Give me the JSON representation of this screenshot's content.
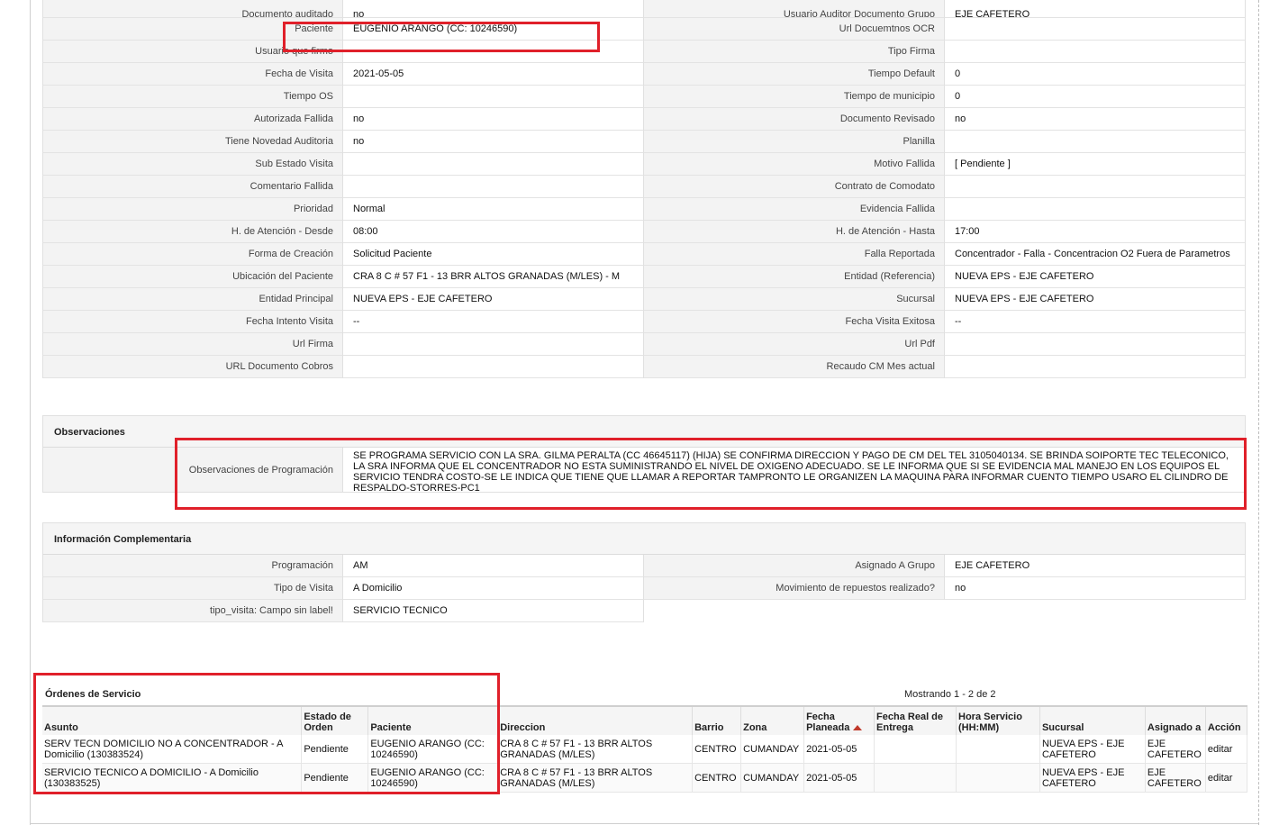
{
  "details": [
    {
      "l1": "Documento auditado",
      "v1": "no",
      "l2": "Usuario Auditor Documento Grupo",
      "v2": "EJE CAFETERO"
    },
    {
      "l1": "Paciente",
      "v1": "EUGENIO ARANGO (CC: 10246590)",
      "l2": "Url Docuemtnos OCR",
      "v2": ""
    },
    {
      "l1": "Usuario que firmo",
      "v1": "",
      "l2": "Tipo Firma",
      "v2": ""
    },
    {
      "l1": "Fecha de Visita",
      "v1": "2021-05-05",
      "l2": "Tiempo Default",
      "v2": "0"
    },
    {
      "l1": "Tiempo OS",
      "v1": "",
      "l2": "Tiempo de municipio",
      "v2": "0"
    },
    {
      "l1": "Autorizada Fallida",
      "v1": "no",
      "l2": "Documento Revisado",
      "v2": "no"
    },
    {
      "l1": "Tiene Novedad Auditoria",
      "v1": "no",
      "l2": "Planilla",
      "v2": ""
    },
    {
      "l1": "Sub Estado Visita",
      "v1": "",
      "l2": "Motivo Fallida",
      "v2": "[ Pendiente ]"
    },
    {
      "l1": "Comentario Fallida",
      "v1": "",
      "l2": "Contrato de Comodato",
      "v2": ""
    },
    {
      "l1": "Prioridad",
      "v1": "Normal",
      "l2": "Evidencia Fallida",
      "v2": ""
    },
    {
      "l1": "H. de Atención - Desde",
      "v1": "08:00",
      "l2": "H. de Atención - Hasta",
      "v2": "17:00"
    },
    {
      "l1": "Forma de Creación",
      "v1": "Solicitud Paciente",
      "l2": "Falla Reportada",
      "v2": "Concentrador - Falla - Concentracion O2 Fuera de Parametros"
    },
    {
      "l1": "Ubicación del Paciente",
      "v1": "CRA 8 C # 57 F1 - 13 BRR ALTOS GRANADAS (M/LES) - M",
      "l2": "Entidad (Referencia)",
      "v2": "NUEVA EPS - EJE CAFETERO"
    },
    {
      "l1": "Entidad Principal",
      "v1": "NUEVA EPS - EJE CAFETERO",
      "l2": "Sucursal",
      "v2": "NUEVA EPS - EJE CAFETERO"
    },
    {
      "l1": "Fecha Intento Visita",
      "v1": "--",
      "l2": "Fecha Visita Exitosa",
      "v2": "--"
    },
    {
      "l1": "Url Firma",
      "v1": "",
      "l2": "Url Pdf",
      "v2": ""
    },
    {
      "l1": "URL Documento Cobros",
      "v1": "",
      "l2": "Recaudo CM Mes actual",
      "v2": ""
    }
  ],
  "observaciones": {
    "header": "Observaciones",
    "label": "Observaciones de Programación",
    "text": " SE PROGRAMA SERVICIO CON LA SRA. GILMA PERALTA (CC 46645117) (HIJA) SE CONFIRMA DIRECCION Y PAGO DE CM DEL TEL 3105040134. SE BRINDA SOIPORTE TEC TELECONICO, LA SRA INFORMA QUE EL CONCENTRADOR NO ESTA SUMINISTRANDO EL NIVEL DE OXIGENO ADECUADO. SE LE INFORMA QUE SI SE EVIDENCIA MAL MANEJO EN LOS EQUIPOS EL SERVICIO TENDRA COSTO-SE LE INDICA QUE TIENE QUE LLAMAR A REPORTAR TAMPRONTO LE ORGANIZEN LA MAQUINA PARA INFORMAR CUENTO TIEMPO USARO EL CILINDRO DE RESPALDO-STORRES-PC1"
  },
  "complementaria": {
    "header": "Información Complementaria",
    "rows": [
      {
        "l1": "Programación",
        "v1": "AM",
        "l2": "Asignado A Grupo",
        "v2": "EJE CAFETERO"
      },
      {
        "l1": "Tipo de Visita",
        "v1": "A Domicilio",
        "l2": "Movimiento de repuestos realizado?",
        "v2": "no"
      },
      {
        "l1": "tipo_visita: Campo sin label!",
        "v1": "SERVICIO TECNICO"
      }
    ]
  },
  "orders": {
    "title": "Órdenes de Servicio",
    "showing": "Mostrando 1 - 2 de 2",
    "columns": [
      "Asunto",
      "Estado de Orden",
      "Paciente",
      "Direccion",
      "Barrio",
      "Zona",
      "Fecha Planeada",
      "Fecha Real de Entrega",
      "Hora Servicio (HH:MM)",
      "Sucursal",
      "Asignado a",
      "Acción"
    ],
    "rows": [
      {
        "asunto": "SERV TECN DOMICILIO NO A CONCENTRADOR - A Domicilio (130383524)",
        "estado": "Pendiente",
        "paciente": "EUGENIO ARANGO (CC: 10246590)",
        "direccion": "CRA 8 C # 57 F1 - 13 BRR ALTOS GRANADAS (M/LES)",
        "barrio": "CENTRO",
        "zona": "CUMANDAY",
        "fecha_planeada": "2021-05-05",
        "fecha_real": "",
        "hora": "",
        "sucursal": "NUEVA EPS - EJE CAFETERO",
        "asignado": "EJE CAFETERO",
        "accion": "editar"
      },
      {
        "asunto": "SERVICIO TECNICO A DOMICILIO - A Domicilio (130383525)",
        "estado": "Pendiente",
        "paciente": "EUGENIO ARANGO (CC: 10246590)",
        "direccion": "CRA 8 C # 57 F1 - 13 BRR ALTOS GRANADAS (M/LES)",
        "barrio": "CENTRO",
        "zona": "CUMANDAY",
        "fecha_planeada": "2021-05-05",
        "fecha_real": "",
        "hora": "",
        "sucursal": "NUEVA EPS - EJE CAFETERO",
        "asignado": "EJE CAFETERO",
        "accion": "editar"
      }
    ]
  },
  "colors": {
    "highlight": "#e0202a",
    "link": "#2a5db0",
    "sort_arrow": "#c0392b"
  }
}
